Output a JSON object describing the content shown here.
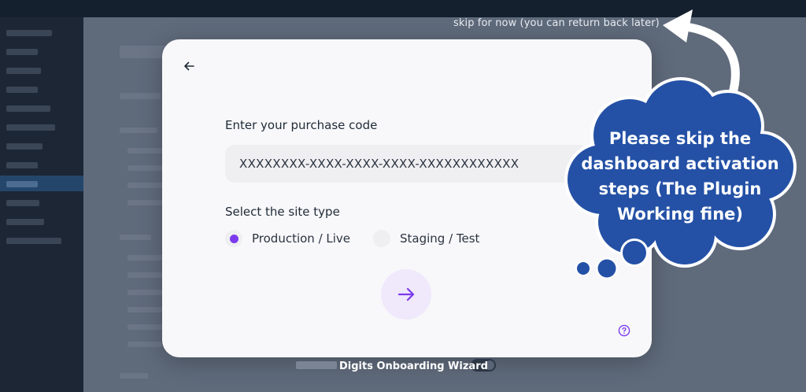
{
  "skip_link": "skip for now (you can return back later)",
  "modal": {
    "purchase_label": "Enter your purchase code",
    "purchase_value": "XXXXXXXX-XXXX-XXXX-XXXX-XXXXXXXXXXXX",
    "site_type_label": "Select the site type",
    "options": [
      {
        "label": "Production / Live",
        "selected": true
      },
      {
        "label": "Staging / Test",
        "selected": false
      }
    ]
  },
  "footer": {
    "wizard_title": "Digits Onboarding Wizard"
  },
  "callout": {
    "text": "Please skip the dashboard activation steps (The Plugin Working fine)"
  },
  "colors": {
    "accent": "#7c3aed",
    "cloud": "#2451a6",
    "backdrop": "#5f6a7b"
  }
}
